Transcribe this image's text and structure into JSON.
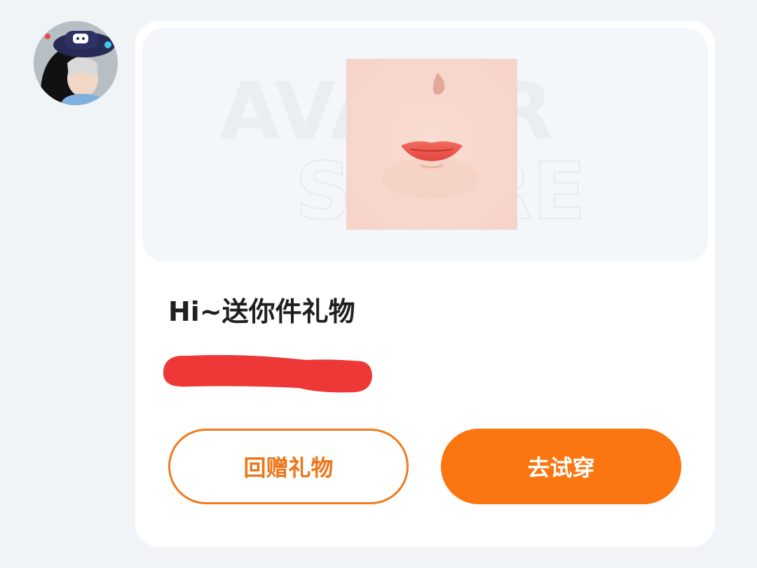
{
  "sender": {
    "avatar_icon": "user-avatar-icon"
  },
  "gift_card": {
    "banner": {
      "watermark_line1": "AVATAR",
      "watermark_line2": "STORE",
      "product_icon": "face-makeup-lips-icon"
    },
    "title": "Hi~送你件礼物",
    "message_redacted": true,
    "redaction_color": "#ee3838"
  },
  "actions": {
    "return_gift_label": "回赠礼物",
    "try_on_label": "去试穿"
  },
  "colors": {
    "accent": "#fb7510",
    "page_background": "#f0f4f6",
    "card_background": "#ffffff"
  }
}
